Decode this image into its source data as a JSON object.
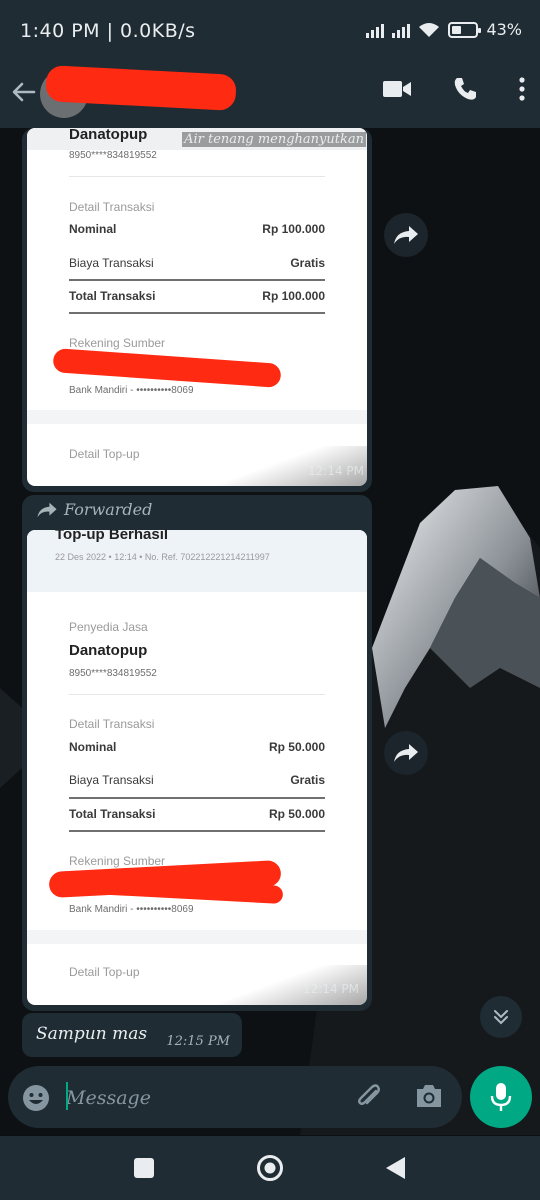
{
  "status_bar": {
    "time": "1:40 PM | 0.0KB/s",
    "battery": "43%",
    "battery_level": 0.43
  },
  "app_bar": {
    "contact_name": ""
  },
  "watermark": "Air tenang menghanyutkan",
  "receipt1": {
    "provider": "Danatopup",
    "number": "8950****834819552",
    "detail_title": "Detail Transaksi",
    "nominal_label": "Nominal",
    "nominal_value": "Rp 100.000",
    "fee_label": "Biaya Transaksi",
    "fee_value": "Gratis",
    "total_label": "Total Transaksi",
    "total_value": "Rp 100.000",
    "source_label": "Rekening Sumber",
    "bank": "Bank Mandiri - ••••••••••8069",
    "topup_label": "Detail Top-up",
    "time": "12:14 PM"
  },
  "forwarded_label": "Forwarded",
  "receipt2": {
    "title": "Top-up Berhasil",
    "date_ref": "22 Des 2022 • 12:14 • No. Ref. 702212221214211997",
    "provider_label": "Penyedia Jasa",
    "provider": "Danatopup",
    "number": "8950****834819552",
    "detail_title": "Detail Transaksi",
    "nominal_label": "Nominal",
    "nominal_value": "Rp 50.000",
    "fee_label": "Biaya Transaksi",
    "fee_value": "Gratis",
    "total_label": "Total Transaksi",
    "total_value": "Rp 50.000",
    "source_label": "Rekening Sumber",
    "bank": "Bank Mandiri - ••••••••••8069",
    "topup_label": "Detail Top-up",
    "time": "12:14 PM"
  },
  "text_message": {
    "text": "Sampun mas",
    "time": "12:15 PM"
  },
  "composer": {
    "placeholder": "Message"
  },
  "colors": {
    "accent": "#00a884",
    "bar": "#1f2c33",
    "redaction": "#ff2a12"
  }
}
